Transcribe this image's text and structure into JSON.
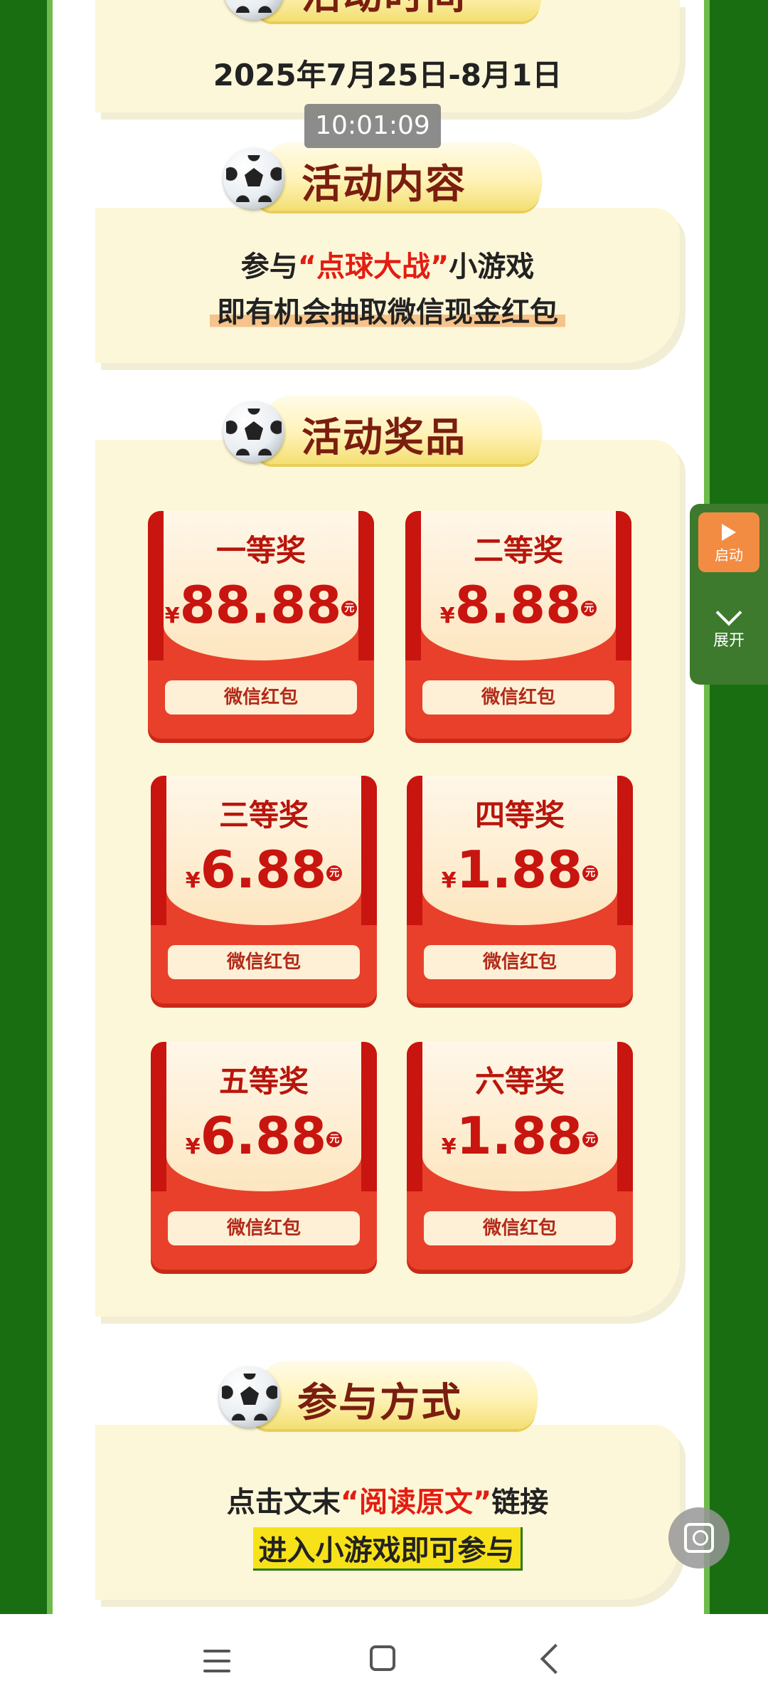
{
  "sections": {
    "time": {
      "title": "活动时间",
      "date": "2025年7月25日-8月1日"
    },
    "content": {
      "title": "活动内容",
      "line1_pre": "参与",
      "line1_highlight": "“点球大战”",
      "line1_post": "小游戏",
      "line2": "即有机会抽取微信现金红包"
    },
    "prizes": {
      "title": "活动奖品",
      "items": [
        {
          "name": "一等奖",
          "yen": "¥",
          "amount": "88.88",
          "unit": "元",
          "button": "微信红包"
        },
        {
          "name": "二等奖",
          "yen": "¥",
          "amount": "8.88",
          "unit": "元",
          "button": "微信红包"
        },
        {
          "name": "三等奖",
          "yen": "¥",
          "amount": "6.88",
          "unit": "元",
          "button": "微信红包"
        },
        {
          "name": "四等奖",
          "yen": "¥",
          "amount": "1.88",
          "unit": "元",
          "button": "微信红包"
        },
        {
          "name": "五等奖",
          "yen": "¥",
          "amount": "6.88",
          "unit": "元",
          "button": "微信红包"
        },
        {
          "name": "六等奖",
          "yen": "¥",
          "amount": "1.88",
          "unit": "元",
          "button": "微信红包"
        }
      ]
    },
    "join": {
      "title": "参与方式",
      "line1_pre": "点击文末",
      "line1_highlight": "“阅读原文”",
      "line1_post": "链接",
      "line2": "进入小游戏即可参与"
    }
  },
  "overlay": {
    "time_chip": "10:01:09"
  },
  "floating_panel": {
    "start_label": "启动",
    "expand_label": "展开"
  },
  "icons": [
    "soccer-ball-icon",
    "play-icon",
    "chevron-down-icon",
    "scan-icon",
    "menu-icon",
    "home-icon",
    "back-icon"
  ],
  "colors": {
    "background_green": "#1a6e12",
    "card_cream": "#fdf7d9",
    "prize_red": "#e8402a",
    "highlight_red": "#e31d12",
    "highlight_yellow": "#f7e21a"
  }
}
